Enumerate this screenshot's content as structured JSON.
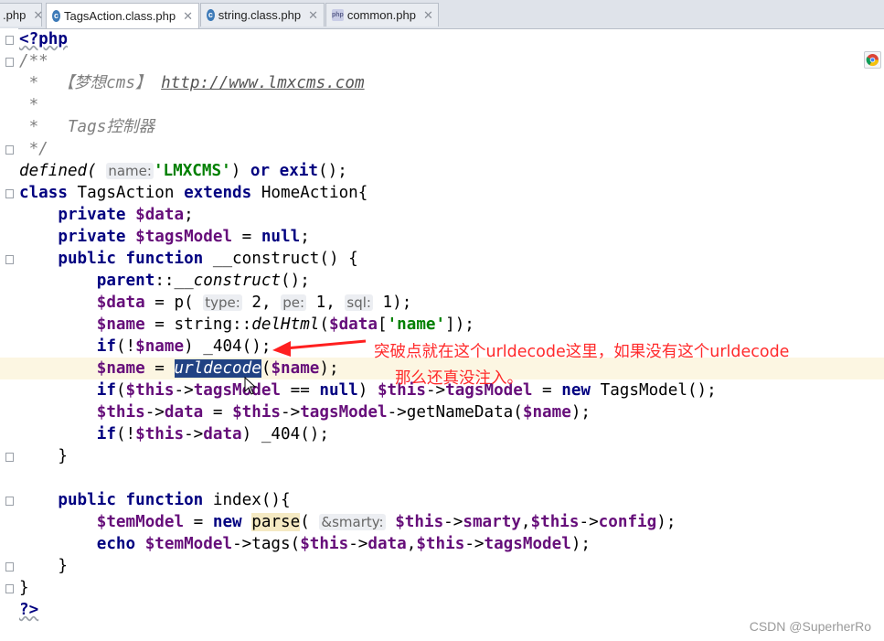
{
  "tabs": [
    {
      "label": ".php",
      "icon": "php-file-icon",
      "close": "✕",
      "active": false
    },
    {
      "label": "TagsAction.class.php",
      "icon": "class-file-icon",
      "close": "✕",
      "active": true
    },
    {
      "label": "string.class.php",
      "icon": "class-file-icon",
      "close": "✕",
      "active": false
    },
    {
      "label": "common.php",
      "icon": "php-file-icon",
      "close": "✕",
      "active": false
    }
  ],
  "icons": {
    "file_tag": "php",
    "class_glyph": "c"
  },
  "code": {
    "l1": "<?php",
    "l2": "/**",
    "l3a": " *  【梦想cms】 ",
    "l3b": "http://www.lmxcms.com",
    "l4": " *",
    "l5": " *   Tags控制器",
    "l6": " */",
    "l7a": "defined(",
    "l7hint": "name:",
    "l7str": "'LMXCMS'",
    "l7b": ") ",
    "l7or": "or",
    "l7exit": "exit",
    "l7c": "();",
    "l8class": "class",
    "l8name": " TagsAction ",
    "l8ext": "extends",
    "l8base": " HomeAction{",
    "l9kw": "private",
    "l9var": "$data",
    "l9end": ";",
    "l10kw": "private",
    "l10var": "$tagsModel",
    "l10eq": " = ",
    "l10null": "null",
    "l10end": ";",
    "l11pub": "public",
    "l11fn": "function",
    "l11rest": " __construct() {",
    "l12parent": "parent",
    "l12sep": "::",
    "l12fn": "__construct",
    "l12end": "();",
    "l13var": "$data",
    "l13a": " = p(",
    "l13h1": "type:",
    "l13v1": " 2, ",
    "l13h2": "pe:",
    "l13v2": " 1, ",
    "l13h3": "sql:",
    "l13v3": " 1);",
    "l14var": "$name",
    "l14a": " = string::",
    "l14fn": "delHtml",
    "l14b": "(",
    "l14var2": "$data",
    "l14c": "[",
    "l14str": "'name'",
    "l14d": "]);",
    "l15if": "if",
    "l15a": "(!",
    "l15var": "$name",
    "l15b": ") _404();",
    "l16var": "$name",
    "l16a": " = ",
    "l16sel": "urldecode",
    "l16b": "(",
    "l16var2": "$name",
    "l16c": ");",
    "l17if": "if",
    "l17a": "(",
    "l17this": "$this",
    "l17b": "->",
    "l17prop": "tagsModel",
    "l17c": " == ",
    "l17null": "null",
    "l17d": ") ",
    "l17this2": "$this",
    "l17e": "->",
    "l17prop2": "tagsModel",
    "l17f": " = ",
    "l17new": "new",
    "l17g": " TagsModel();",
    "l18this": "$this",
    "l18a": "->",
    "l18prop": "data",
    "l18b": " = ",
    "l18this2": "$this",
    "l18c": "->",
    "l18prop2": "tagsModel",
    "l18d": "->getNameData(",
    "l18var": "$name",
    "l18e": ");",
    "l19if": "if",
    "l19a": "(!",
    "l19this": "$this",
    "l19b": "->",
    "l19prop": "data",
    "l19c": ") _404();",
    "l20": "}",
    "l22pub": "public",
    "l22fn": "function",
    "l22rest": " index(){",
    "l23var": "$temModel",
    "l23a": " = ",
    "l23new": "new",
    "l23b": " ",
    "l23parse": "parse",
    "l23c": "( ",
    "l23hint": "&smarty:",
    "l23d": " ",
    "l23this": "$this",
    "l23e": "->",
    "l23prop": "smarty",
    "l23f": ",",
    "l23this2": "$this",
    "l23g": "->",
    "l23prop2": "config",
    "l23h": ");",
    "l24echo": "echo",
    "l24a": " ",
    "l24var": "$temModel",
    "l24b": "->tags(",
    "l24this": "$this",
    "l24c": "->",
    "l24prop": "data",
    "l24d": ",",
    "l24this2": "$this",
    "l24e": "->",
    "l24prop2": "tagsModel",
    "l24f": ");",
    "l25": "}",
    "l26": "}",
    "l27": "?>"
  },
  "annotation": {
    "line1": "突破点就在这个urldecode这里，如果没有这个urldecode",
    "line2": "那么还真没注入。",
    "color": "#ff2a2a"
  },
  "watermark": "CSDN @SuperherRo",
  "colors": {
    "keyword": "#000080",
    "variable": "#660e7a",
    "string": "#008000",
    "comment": "#808080",
    "selection": "#214283",
    "current_line": "#fcf6e2"
  }
}
